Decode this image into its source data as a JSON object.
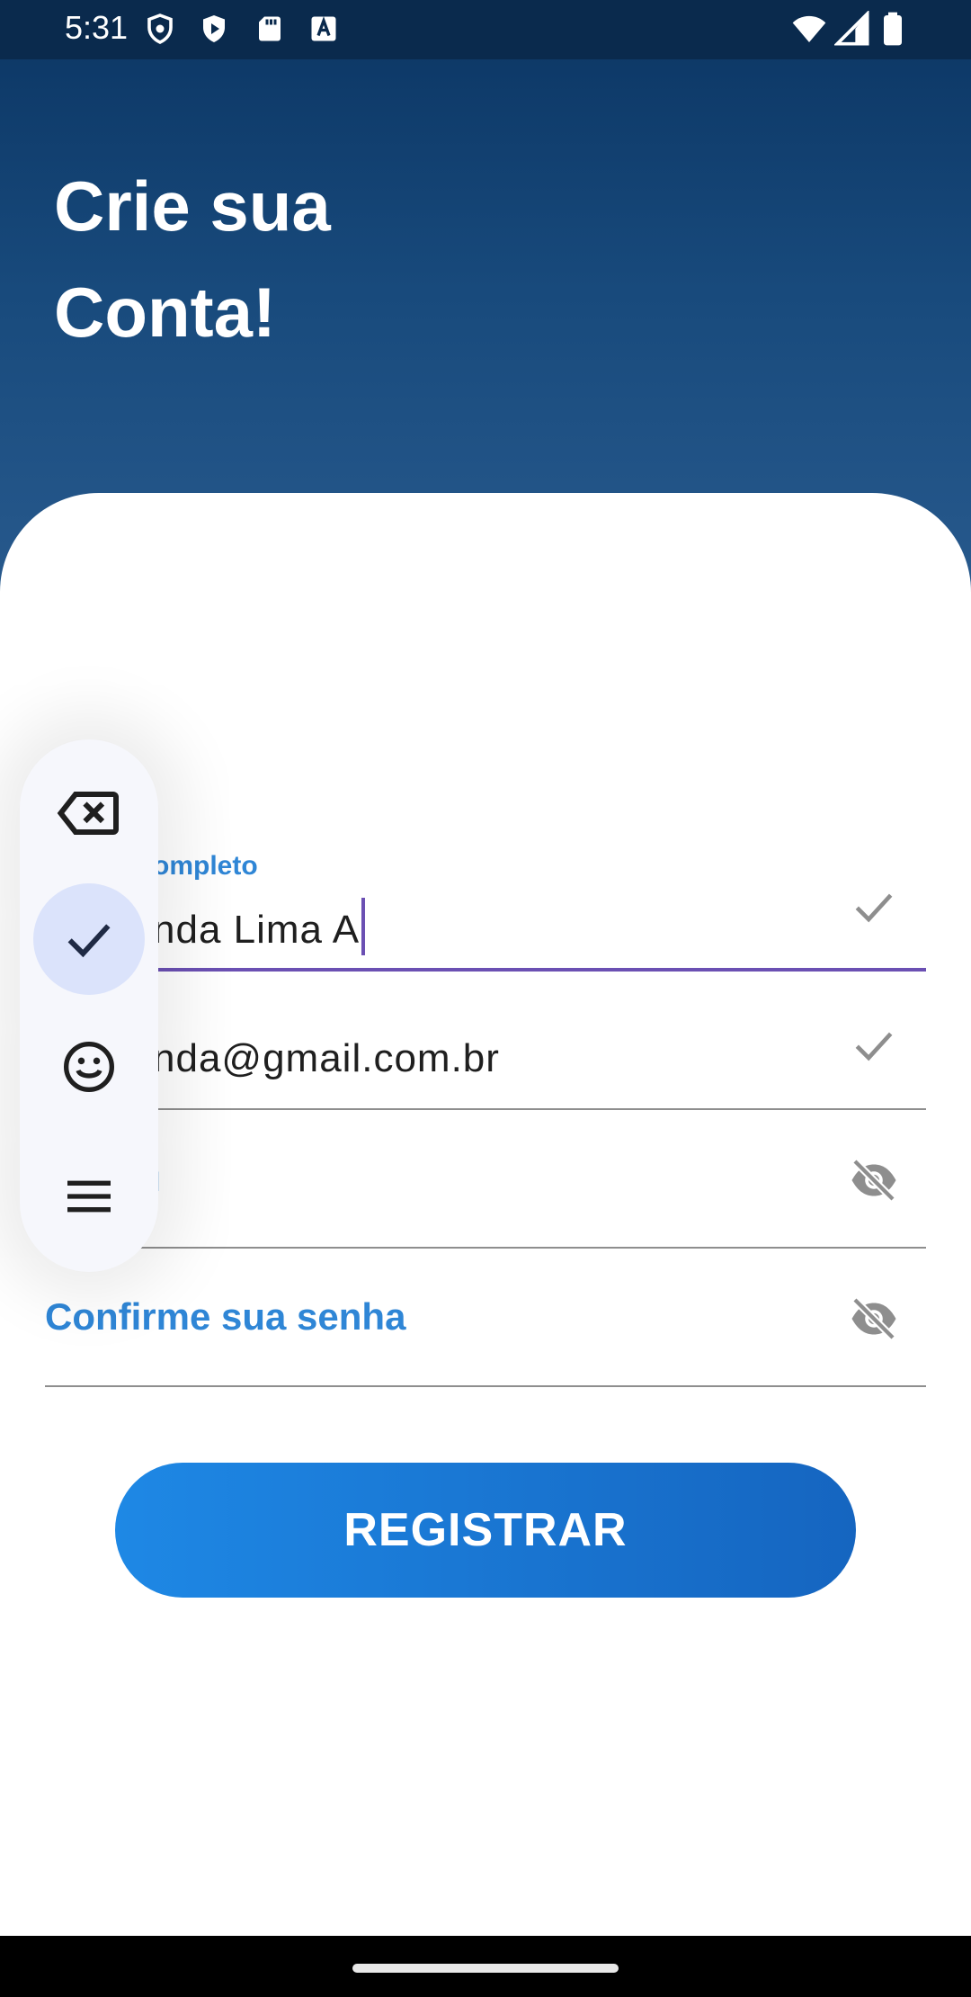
{
  "status_bar": {
    "time": "5:31",
    "icons_left": [
      "shield-icon",
      "play-icon",
      "sd-card-icon",
      "keyboard-a-icon"
    ],
    "icons_right": [
      "wifi-icon",
      "signal-icon",
      "battery-icon"
    ]
  },
  "header": {
    "title_line1": "Crie sua",
    "title_line2": "Conta!"
  },
  "form": {
    "name": {
      "label": "ompleto",
      "value": "nda Lima A"
    },
    "email": {
      "value": "nda@gmail.com.br"
    },
    "password": {
      "label": "l"
    },
    "confirm_password": {
      "label": "Confirme sua senha"
    }
  },
  "register_button": {
    "label": "REGISTRAR"
  },
  "floating_keyboard_toolbar": {
    "items": [
      "backspace-icon",
      "check-icon",
      "emoji-icon",
      "menu-icon"
    ],
    "selected": "check-icon"
  },
  "colors": {
    "header_top": "#0b3563",
    "header_bottom": "#2a5c90",
    "label_blue": "#2f86d6",
    "active_underline": "#6b50b3",
    "button_start": "#1e88e5",
    "button_end": "#1565c0"
  }
}
